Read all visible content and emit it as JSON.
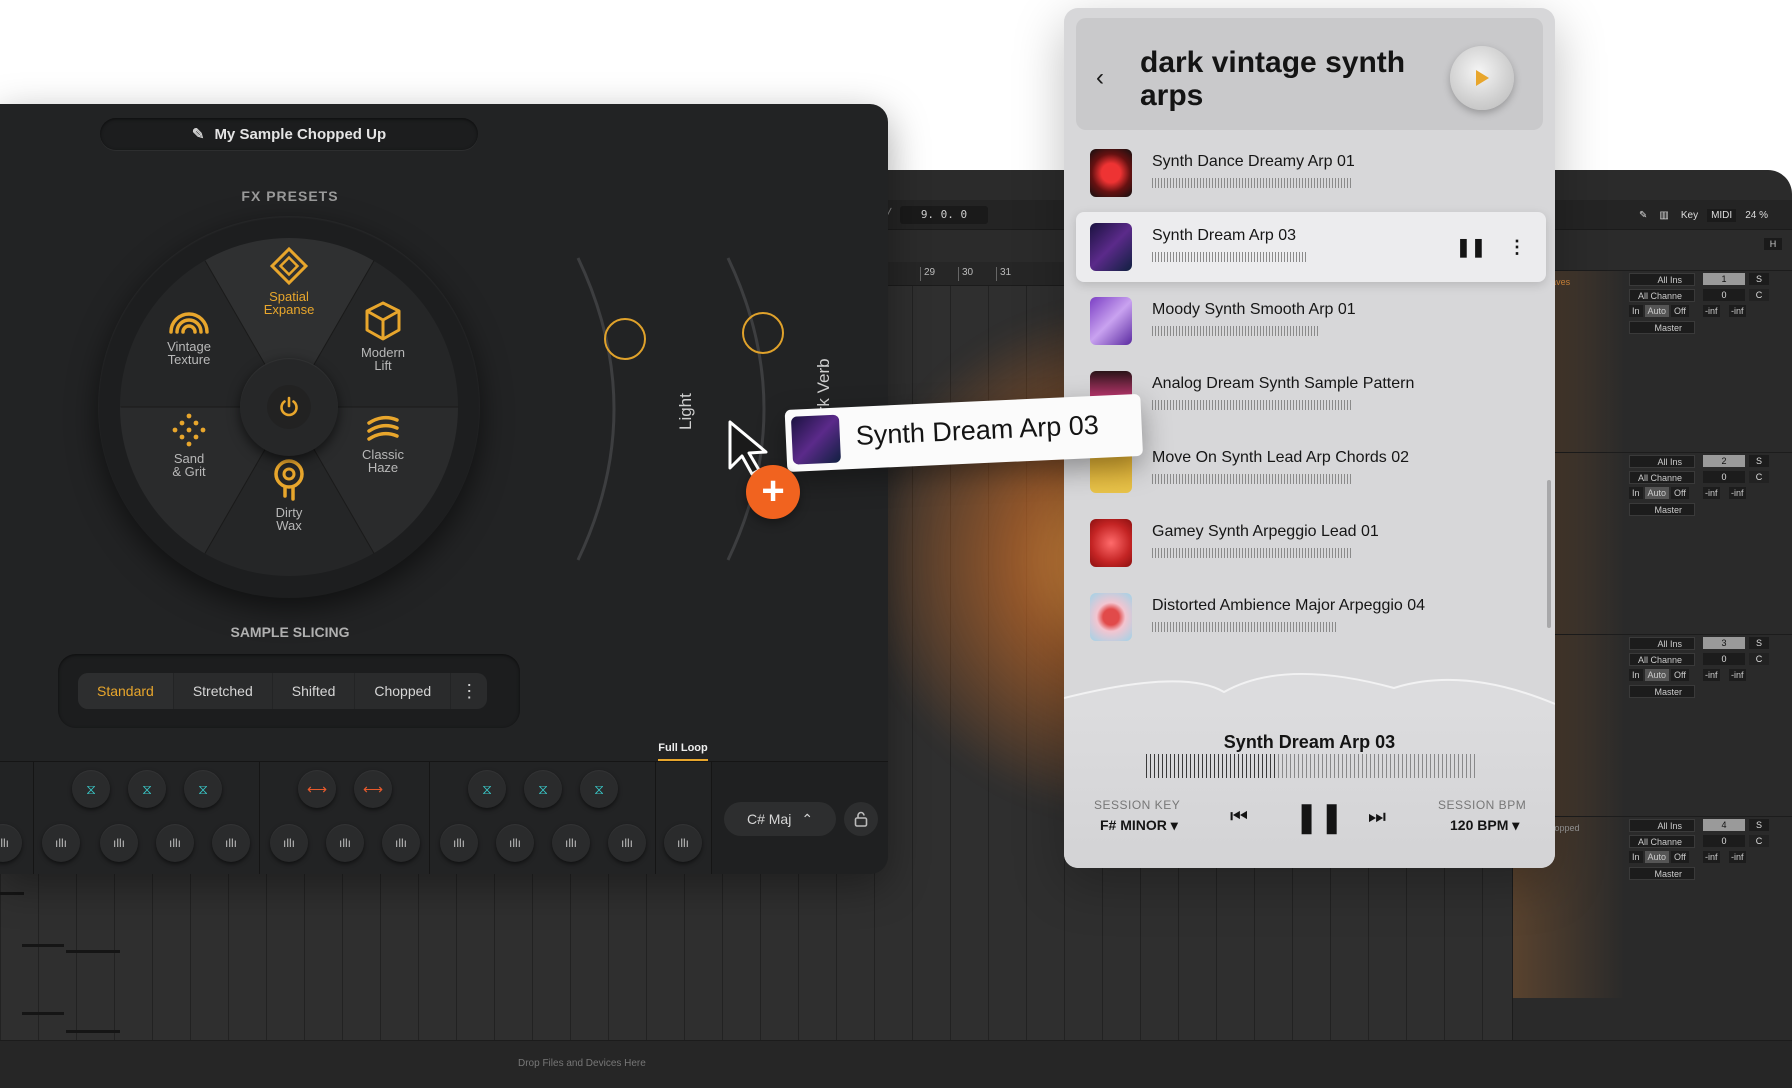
{
  "plugin": {
    "sample_name": "My Sample Chopped Up",
    "fx_title": "FX PRESETS",
    "presets": [
      {
        "label": "Spatial Expanse",
        "lines": [
          "Spatial",
          "Expanse"
        ],
        "icon": "diamond-icon",
        "active": true
      },
      {
        "label": "Modern Lift",
        "lines": [
          "Modern",
          "Lift"
        ],
        "icon": "cube-icon",
        "active": false
      },
      {
        "label": "Classic Haze",
        "lines": [
          "Classic",
          "Haze"
        ],
        "icon": "waves-icon",
        "active": false
      },
      {
        "label": "Dirty Wax",
        "lines": [
          "Dirty",
          "Wax"
        ],
        "icon": "record-drip-icon",
        "active": false
      },
      {
        "label": "Sand & Grit",
        "lines": [
          "Sand",
          "& Grit"
        ],
        "icon": "dots-icon",
        "active": false
      },
      {
        "label": "Vintage Texture",
        "lines": [
          "Vintage",
          "Texture"
        ],
        "icon": "rainbow-icon",
        "active": false
      }
    ],
    "knob_light_label": "Light",
    "knob_verb_label": "Dark Verb",
    "slicing_title": "SAMPLE SLICING",
    "slicing_tabs": [
      "Standard",
      "Stretched",
      "Shifted",
      "Chopped"
    ],
    "slicing_active": "Standard",
    "full_loop_label": "Full Loop",
    "key_value": "C# Maj",
    "accent_color": "#e8a62c"
  },
  "search_panel": {
    "title": "dark vintage synth arps",
    "tracks": [
      {
        "name": "Synth Dance Dreamy Arp 01"
      },
      {
        "name": "Synth Dream Arp 03",
        "selected": true
      },
      {
        "name": "Moody Synth Smooth Arp 01"
      },
      {
        "name": "Analog Dream Synth Sample Pattern"
      },
      {
        "name": "Move On Synth Lead Arp Chords 02"
      },
      {
        "name": "Gamey Synth Arpeggio Lead 01"
      },
      {
        "name": "Distorted Ambience Major Arpeggio 04"
      }
    ],
    "now_playing": "Synth Dream Arp 03",
    "session_key_label": "SESSION KEY",
    "session_key_value": "F# MINOR ▾",
    "session_bpm_label": "SESSION BPM",
    "session_bpm_value": "120 BPM ▾"
  },
  "drag_chip": {
    "name": "Synth Dream Arp 03"
  },
  "daw": {
    "position": "9. 0. 0",
    "ruler": [
      "29",
      "30",
      "31"
    ],
    "tools": {
      "key": "Key",
      "midi": "MIDI",
      "zoom": "24 %"
    },
    "h_label": "H",
    "tracks": [
      {
        "label": "Waves",
        "number": "1"
      },
      {
        "label": "",
        "number": "2"
      },
      {
        "label": "d",
        "number": "3"
      },
      {
        "label": "Chopped",
        "number": "4"
      }
    ],
    "mixer": {
      "input": "All Ins",
      "channel": "All Channe",
      "in": "In",
      "auto": "Auto",
      "off": "Off",
      "output": "Master",
      "s": "S",
      "c": "C",
      "zero": "0",
      "inf": "-inf"
    },
    "drop_hint": "Drop Files and Devices Here"
  }
}
